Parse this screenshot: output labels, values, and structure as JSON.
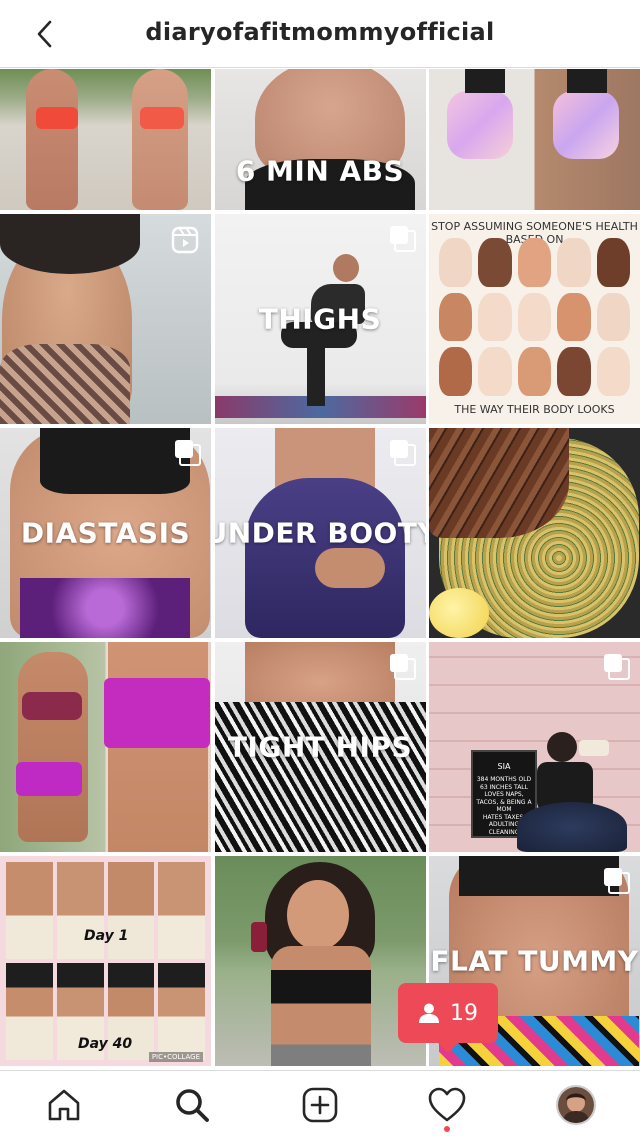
{
  "header": {
    "title": "diaryofafitmommyofficial",
    "back_icon": "chevron-left-icon"
  },
  "tiles": [
    {
      "id": "t1",
      "overlay": ""
    },
    {
      "id": "t2",
      "overlay": "6 MIN ABS"
    },
    {
      "id": "t3",
      "overlay": ""
    },
    {
      "id": "t4",
      "overlay": "",
      "icon": "reel-icon"
    },
    {
      "id": "t5",
      "overlay": "THIGHS",
      "icon": "multiple-photos-icon"
    },
    {
      "id": "t6",
      "overlay": "",
      "poster_top": "STOP ASSUMING SOMEONE'S HEALTH BASED ON",
      "poster_bottom": "THE WAY THEIR BODY LOOKS"
    },
    {
      "id": "t7",
      "overlay": "DIASTASIS",
      "icon": "multiple-photos-icon"
    },
    {
      "id": "t8",
      "overlay": "UNDER BOOTY",
      "icon": "multiple-photos-icon"
    },
    {
      "id": "t9",
      "overlay": ""
    },
    {
      "id": "t10",
      "overlay": ""
    },
    {
      "id": "t11",
      "overlay": "TIGHT HIPS",
      "icon": "multiple-photos-icon"
    },
    {
      "id": "t12",
      "overlay": "",
      "icon": "multiple-photos-icon",
      "sign_title": "SIA",
      "sign_lines": [
        "384 MONTHS OLD",
        "63 INCHES TALL",
        "LOVES NAPS,",
        "TACOS, & BEING A",
        "MOM",
        "HATES TAXES,",
        "ADULTING",
        "CLEANING"
      ]
    },
    {
      "id": "t13",
      "overlay": "",
      "day_top": "Day 1",
      "day_bottom": "Day 40",
      "watermark": "PIC•COLLAGE"
    },
    {
      "id": "t14",
      "overlay": ""
    },
    {
      "id": "t15",
      "overlay": "FLAT TUMMY",
      "icon": "multiple-photos-icon"
    }
  ],
  "notification": {
    "count": "19",
    "icon": "person-icon"
  },
  "bottom_nav": {
    "items": [
      {
        "name": "home",
        "icon": "home-icon"
      },
      {
        "name": "search",
        "icon": "search-icon"
      },
      {
        "name": "create",
        "icon": "add-post-icon"
      },
      {
        "name": "activity",
        "icon": "heart-icon"
      },
      {
        "name": "profile",
        "icon": "avatar-icon"
      }
    ]
  },
  "colors": {
    "accent": "#ed4956",
    "text": "#262626",
    "divider": "#dbdbdb"
  }
}
